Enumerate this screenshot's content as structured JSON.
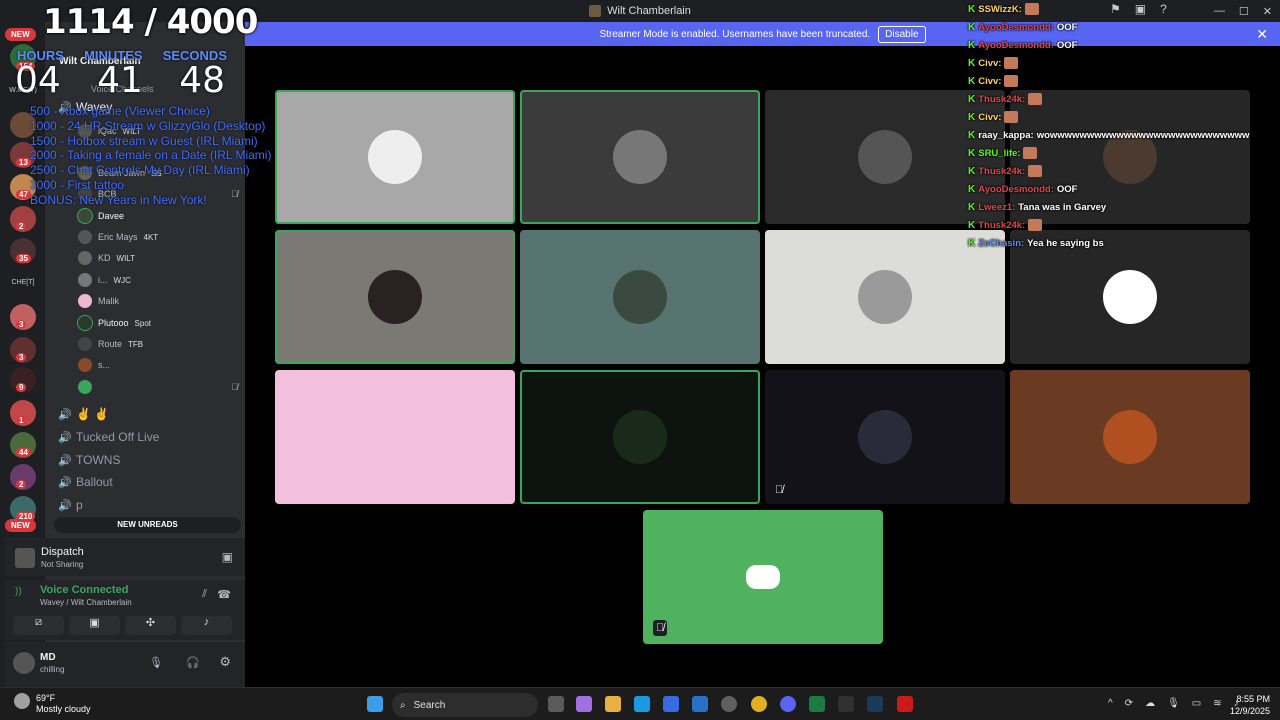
{
  "window": {
    "title": "Wilt Chamberlain"
  },
  "banner": {
    "text": "Streamer Mode is enabled. Usernames have been truncated.",
    "button": "Disable"
  },
  "overlay": {
    "count": "1114 / 4000",
    "labels": [
      "HOURS",
      "MINUTES",
      "SECONDS"
    ],
    "values": [
      "04",
      "41",
      "48"
    ],
    "goals": [
      "500 - Xbox game (Viewer Choice)",
      "1000 - 24 HR Stream w GlizzyGlo (Desktop)",
      "1500 - Hotbox stream w Guest (IRL Miami)",
      "2000 - Taking a female on a Date (IRL Miami)",
      "2500 - Chat Controls My Day (IRL Miami)",
      "3000 - First tattoo",
      "BONUS: New Years in New York!"
    ]
  },
  "guilds": {
    "new_top": "NEW",
    "new_bottom": "NEW",
    "labels": [
      "W.MF(V)",
      "CHE[T]"
    ],
    "badges": [
      "154",
      "13",
      "47",
      "2",
      "35",
      "3",
      "3",
      "9",
      "1",
      "44",
      "2",
      "210"
    ]
  },
  "sidebar": {
    "server": "Wilt Chamberlain",
    "category": "Voice Channels",
    "channel_active": "Wavey",
    "members": [
      {
        "name": "iQac",
        "tag": "WILT"
      },
      {
        "name": "Beam Jawn",
        "tag": "SS"
      },
      {
        "name": "BCB",
        "tag": ""
      },
      {
        "name": "Davee",
        "tag": ""
      },
      {
        "name": "Eric Mays",
        "tag": "4KT"
      },
      {
        "name": "KD",
        "tag": "WILT"
      },
      {
        "name": "i...",
        "tag": "WJC"
      },
      {
        "name": "Malik",
        "tag": ""
      },
      {
        "name": "Plutooo",
        "tag": "Spot"
      },
      {
        "name": "Route",
        "tag": "TFB"
      },
      {
        "name": "s...",
        "tag": ""
      }
    ],
    "channels": [
      "✌️ ✌️",
      "Tucked Off Live",
      "TOWNS",
      "Ballout",
      "p"
    ],
    "new_unreads": "NEW UNREADS",
    "dispatch": {
      "title": "Dispatch",
      "sub": "Not Sharing"
    },
    "voice": {
      "status": "Voice Connected",
      "location": "Wavey / Wilt Chamberlain"
    },
    "user": {
      "name": "MD",
      "status": "chilling"
    }
  },
  "chat": [
    {
      "user": "SSWizzK:",
      "color": "#ffd15c",
      "msg": ""
    },
    {
      "user": "AyooDesmondd:",
      "color": "#e0434b",
      "msg": "OOF"
    },
    {
      "user": "AyooDesmondd:",
      "color": "#e0434b",
      "msg": "OOF"
    },
    {
      "user": "Civv:",
      "color": "#ffd15c",
      "msg": ""
    },
    {
      "user": "Civv:",
      "color": "#ffd15c",
      "msg": ""
    },
    {
      "user": "Thusk24k:",
      "color": "#e0434b",
      "msg": ""
    },
    {
      "user": "Civv:",
      "color": "#ffd15c",
      "msg": ""
    },
    {
      "user": "raay_kappa:",
      "color": "#ffffff",
      "msg": "wowwwwwwwwwwwwwwwwwwwwwwwwwww"
    },
    {
      "user": "SRU_life:",
      "color": "#53fc18",
      "msg": ""
    },
    {
      "user": "Thusk24k:",
      "color": "#e0434b",
      "msg": ""
    },
    {
      "user": "AyooDesmondd:",
      "color": "#e0434b",
      "msg": "OOF"
    },
    {
      "user": "Lweez1:",
      "color": "#e0434b",
      "msg": "Tana was in Garvey"
    },
    {
      "user": "Thusk24k:",
      "color": "#e0434b",
      "msg": ""
    },
    {
      "user": "ZeChasin:",
      "color": "#5b8cff",
      "msg": "Yea he saying bs"
    }
  ],
  "taskbar": {
    "weather_temp": "69°F",
    "weather_desc": "Mostly cloudy",
    "search": "Search",
    "time": "8:55 PM",
    "date": "12/9/2025"
  }
}
